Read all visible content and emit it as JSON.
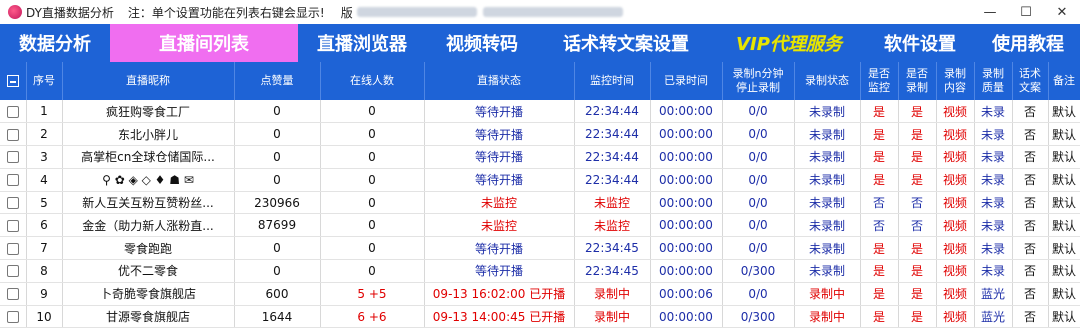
{
  "titlebar": {
    "title": "DY直播数据分析",
    "note": "注：单个设置功能在列表右键会显示!",
    "version_label": "版",
    "minimize": "—",
    "maximize": "☐",
    "close": "✕"
  },
  "menu": [
    {
      "label": "数据分析",
      "active": false
    },
    {
      "label": "直播间列表",
      "active": true
    },
    {
      "label": "直播浏览器",
      "active": false
    },
    {
      "label": "视频转码",
      "active": false
    },
    {
      "label": "话术转文案设置",
      "active": false
    },
    {
      "label": "VIP代理服务",
      "active": false
    },
    {
      "label": "软件设置",
      "active": false
    },
    {
      "label": "使用教程",
      "active": false
    }
  ],
  "table": {
    "headers": [
      "序号",
      "直播昵称",
      "点赞量",
      "在线人数",
      "直播状态",
      "监控时间",
      "已录时间",
      "录制n分钟\n停止录制",
      "录制状态",
      "是否\n监控",
      "是否\n录制",
      "录制\n内容",
      "录制\n质量",
      "话术\n文案",
      "备注"
    ],
    "rows": [
      {
        "idx": "1",
        "name": "疯狂购零食工厂",
        "likes": "0",
        "online": "0",
        "status": "等待开播",
        "mon_time": "22:34:44",
        "rec_time": "00:00:00",
        "stop_after": "0/0",
        "rec_state": "未录制",
        "is_mon": "是",
        "is_rec": "是",
        "content": "视频",
        "quality": "未录",
        "script": "否",
        "note": "默认"
      },
      {
        "idx": "2",
        "name": "东北小胖儿",
        "likes": "0",
        "online": "0",
        "status": "等待开播",
        "mon_time": "22:34:44",
        "rec_time": "00:00:00",
        "stop_after": "0/0",
        "rec_state": "未录制",
        "is_mon": "是",
        "is_rec": "是",
        "content": "视频",
        "quality": "未录",
        "script": "否",
        "note": "默认"
      },
      {
        "idx": "3",
        "name": "高掌柜cn全球仓储国际...",
        "likes": "0",
        "online": "0",
        "status": "等待开播",
        "mon_time": "22:34:44",
        "rec_time": "00:00:00",
        "stop_after": "0/0",
        "rec_state": "未录制",
        "is_mon": "是",
        "is_rec": "是",
        "content": "视频",
        "quality": "未录",
        "script": "否",
        "note": "默认"
      },
      {
        "idx": "4",
        "name": "⚲ ✿ ◈ ◇ ♦ ☗ ✉",
        "likes": "0",
        "online": "0",
        "status": "等待开播",
        "mon_time": "22:34:44",
        "rec_time": "00:00:00",
        "stop_after": "0/0",
        "rec_state": "未录制",
        "is_mon": "是",
        "is_rec": "是",
        "content": "视频",
        "quality": "未录",
        "script": "否",
        "note": "默认"
      },
      {
        "idx": "5",
        "name": "新人互关互粉互赞粉丝...",
        "likes": "230966",
        "online": "0",
        "status": "未监控",
        "mon_time": "未监控",
        "rec_time": "00:00:00",
        "stop_after": "0/0",
        "rec_state": "未录制",
        "is_mon": "否",
        "is_rec": "否",
        "content": "视频",
        "quality": "未录",
        "script": "否",
        "note": "默认"
      },
      {
        "idx": "6",
        "name": "金金（助力新人涨粉直...",
        "likes": "87699",
        "online": "0",
        "status": "未监控",
        "mon_time": "未监控",
        "rec_time": "00:00:00",
        "stop_after": "0/0",
        "rec_state": "未录制",
        "is_mon": "否",
        "is_rec": "否",
        "content": "视频",
        "quality": "未录",
        "script": "否",
        "note": "默认"
      },
      {
        "idx": "7",
        "name": "零食跑跑",
        "likes": "0",
        "online": "0",
        "status": "等待开播",
        "mon_time": "22:34:45",
        "rec_time": "00:00:00",
        "stop_after": "0/0",
        "rec_state": "未录制",
        "is_mon": "是",
        "is_rec": "是",
        "content": "视频",
        "quality": "未录",
        "script": "否",
        "note": "默认"
      },
      {
        "idx": "8",
        "name": "优不二零食",
        "likes": "0",
        "online": "0",
        "status": "等待开播",
        "mon_time": "22:34:45",
        "rec_time": "00:00:00",
        "stop_after": "0/300",
        "rec_state": "未录制",
        "is_mon": "是",
        "is_rec": "是",
        "content": "视频",
        "quality": "未录",
        "script": "否",
        "note": "默认"
      },
      {
        "idx": "9",
        "name": "卜奇脆零食旗舰店",
        "likes": "600",
        "online": "5 +5",
        "status": "09-13 16:02:00 已开播",
        "mon_time": "录制中",
        "rec_time": "00:00:06",
        "stop_after": "0/0",
        "rec_state": "录制中",
        "is_mon": "是",
        "is_rec": "是",
        "content": "视频",
        "quality": "蓝光",
        "script": "否",
        "note": "默认"
      },
      {
        "idx": "10",
        "name": "甘源零食旗舰店",
        "likes": "1644",
        "online": "6 +6",
        "status": "09-13 14:00:45 已开播",
        "mon_time": "录制中",
        "rec_time": "00:00:00",
        "stop_after": "0/300",
        "rec_state": "录制中",
        "is_mon": "是",
        "is_rec": "是",
        "content": "视频",
        "quality": "蓝光",
        "script": "否",
        "note": "默认"
      }
    ]
  },
  "colors": {
    "accent": "#1e63d6",
    "active_tab": "#f06ef0",
    "vip": "#e6e600",
    "red": "#e00000",
    "blue_text": "#1d2ea8"
  }
}
